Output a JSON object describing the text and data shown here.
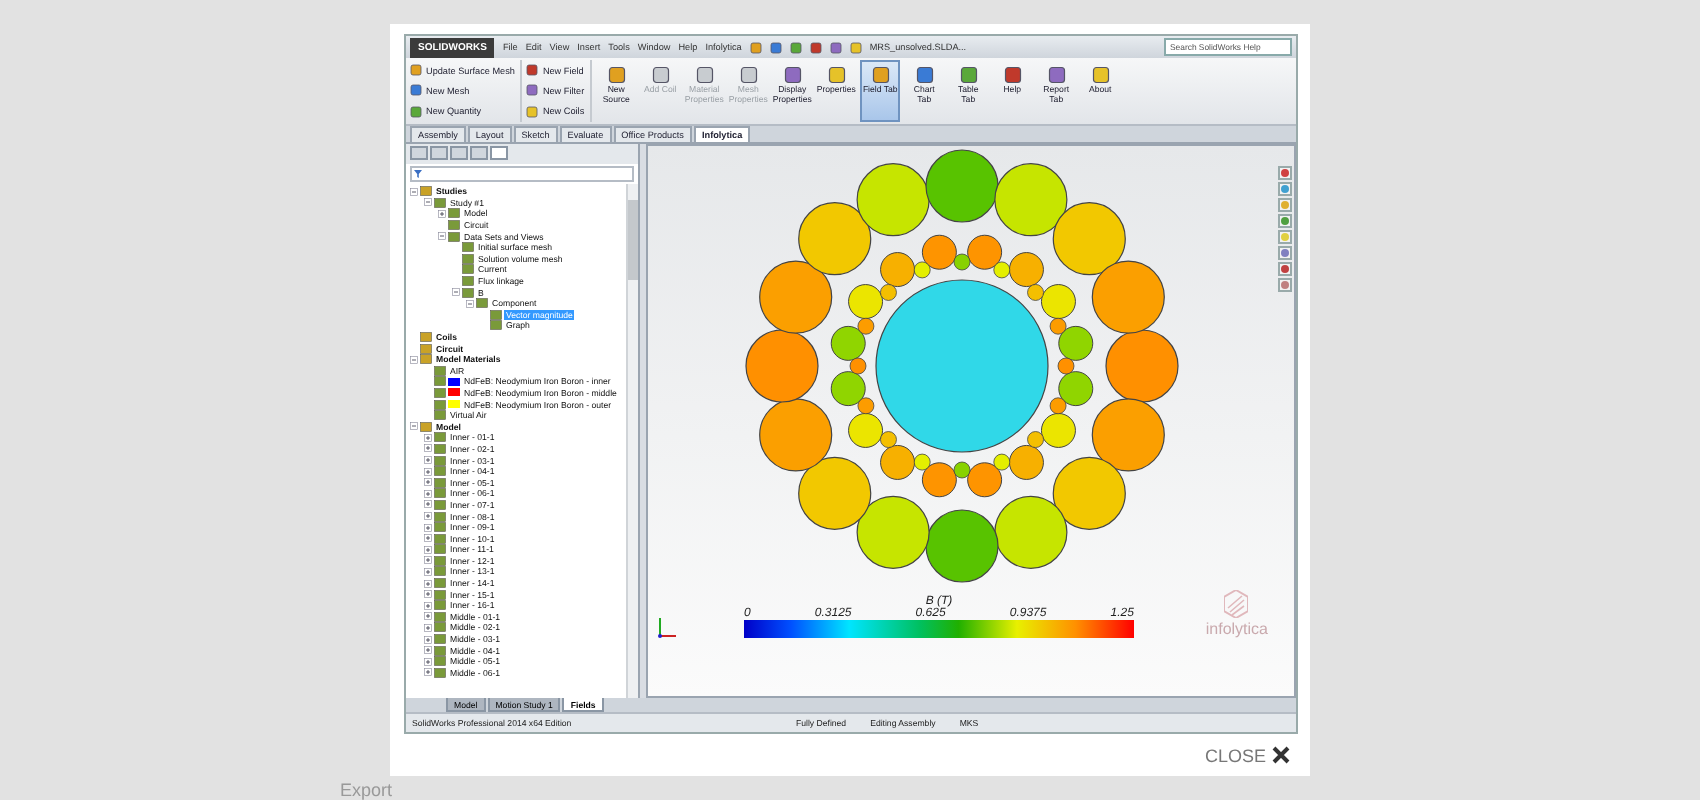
{
  "app": {
    "logo": "SOLIDWORKS",
    "menu": [
      "File",
      "Edit",
      "View",
      "Insert",
      "Tools",
      "Window",
      "Help",
      "Infolytica"
    ],
    "document_title": "MRS_unsolved.SLDA...",
    "search": {
      "placeholder": "Search SolidWorks Help"
    }
  },
  "ribbon": {
    "small_commands": [
      {
        "label": "Update Surface Mesh"
      },
      {
        "label": "New Mesh"
      },
      {
        "label": "New Quantity"
      },
      {
        "label": "New Field"
      },
      {
        "label": "New Filter"
      },
      {
        "label": "New Coils"
      }
    ],
    "large_commands": [
      {
        "label": "New Source",
        "disabled": false,
        "selected": false
      },
      {
        "label": "Add Coil",
        "disabled": true,
        "selected": false
      },
      {
        "label": "Material Properties",
        "disabled": true,
        "selected": false
      },
      {
        "label": "Mesh Properties",
        "disabled": true,
        "selected": false
      },
      {
        "label": "Display Properties",
        "disabled": false,
        "selected": false
      },
      {
        "label": "Properties",
        "disabled": false,
        "selected": false
      },
      {
        "label": "Field Tab",
        "disabled": false,
        "selected": true
      },
      {
        "label": "Chart Tab",
        "disabled": false,
        "selected": false
      },
      {
        "label": "Table Tab",
        "disabled": false,
        "selected": false
      },
      {
        "label": "Help",
        "disabled": false,
        "selected": false
      },
      {
        "label": "Report Tab",
        "disabled": false,
        "selected": false
      },
      {
        "label": "About",
        "disabled": false,
        "selected": false
      }
    ]
  },
  "tabs": [
    {
      "label": "Assembly",
      "selected": false
    },
    {
      "label": "Layout",
      "selected": false
    },
    {
      "label": "Sketch",
      "selected": false
    },
    {
      "label": "Evaluate",
      "selected": false
    },
    {
      "label": "Office Products",
      "selected": false
    },
    {
      "label": "Infolytica",
      "selected": true
    }
  ],
  "panel_tabs": [
    {
      "selected": false
    },
    {
      "selected": false
    },
    {
      "selected": false
    },
    {
      "selected": false
    },
    {
      "selected": true
    }
  ],
  "tree": [
    {
      "label": "Studies",
      "selected": false,
      "expanded": true,
      "children": [
        {
          "label": "Study #1",
          "selected": false,
          "expanded": true,
          "children": [
            {
              "label": "Model",
              "selected": false,
              "expanded": false
            },
            {
              "label": "Circuit",
              "selected": false
            },
            {
              "label": "Data Sets and Views",
              "selected": false,
              "expanded": true,
              "children": [
                {
                  "label": "Initial surface mesh",
                  "selected": false
                },
                {
                  "label": "Solution volume mesh",
                  "selected": false
                },
                {
                  "label": "Current",
                  "selected": false
                },
                {
                  "label": "Flux linkage",
                  "selected": false
                },
                {
                  "label": "B",
                  "selected": false,
                  "expanded": true,
                  "children": [
                    {
                      "label": "Component",
                      "selected": false,
                      "expanded": true,
                      "children": [
                        {
                          "label": "Vector magnitude",
                          "selected": true
                        },
                        {
                          "label": "Graph",
                          "selected": false
                        }
                      ]
                    }
                  ]
                }
              ]
            }
          ]
        }
      ]
    },
    {
      "label": "Coils",
      "selected": false
    },
    {
      "label": "Circuit",
      "selected": false
    },
    {
      "label": "Model Materials",
      "selected": false,
      "expanded": true,
      "children": [
        {
          "label": "AIR",
          "selected": false
        },
        {
          "label": "NdFeB: Neodymium Iron Boron - inner",
          "selected": false,
          "color": "#0000ff"
        },
        {
          "label": "NdFeB: Neodymium Iron Boron - middle",
          "selected": false,
          "color": "#ff0000"
        },
        {
          "label": "NdFeB: Neodymium Iron Boron - outer",
          "selected": false,
          "color": "#ffff00"
        },
        {
          "label": "Virtual Air",
          "selected": false
        }
      ]
    },
    {
      "label": "Model",
      "selected": false,
      "expanded": true,
      "children": [
        {
          "label": "Inner - 01-1",
          "selected": false,
          "expanded": false
        },
        {
          "label": "Inner - 02-1",
          "selected": false,
          "expanded": false
        },
        {
          "label": "Inner - 03-1",
          "selected": false,
          "expanded": false
        },
        {
          "label": "Inner - 04-1",
          "selected": false,
          "expanded": false
        },
        {
          "label": "Inner - 05-1",
          "selected": false,
          "expanded": false
        },
        {
          "label": "Inner - 06-1",
          "selected": false,
          "expanded": false
        },
        {
          "label": "Inner - 07-1",
          "selected": false,
          "expanded": false
        },
        {
          "label": "Inner - 08-1",
          "selected": false,
          "expanded": false
        },
        {
          "label": "Inner - 09-1",
          "selected": false,
          "expanded": false
        },
        {
          "label": "Inner - 10-1",
          "selected": false,
          "expanded": false
        },
        {
          "label": "Inner - 11-1",
          "selected": false,
          "expanded": false
        },
        {
          "label": "Inner - 12-1",
          "selected": false,
          "expanded": false
        },
        {
          "label": "Inner - 13-1",
          "selected": false,
          "expanded": false
        },
        {
          "label": "Inner - 14-1",
          "selected": false,
          "expanded": false
        },
        {
          "label": "Inner - 15-1",
          "selected": false,
          "expanded": false
        },
        {
          "label": "Inner - 16-1",
          "selected": false,
          "expanded": false
        },
        {
          "label": "Middle - 01-1",
          "selected": false,
          "expanded": false
        },
        {
          "label": "Middle - 02-1",
          "selected": false,
          "expanded": false
        },
        {
          "label": "Middle - 03-1",
          "selected": false,
          "expanded": false
        },
        {
          "label": "Middle - 04-1",
          "selected": false,
          "expanded": false
        },
        {
          "label": "Middle - 05-1",
          "selected": false,
          "expanded": false
        },
        {
          "label": "Middle - 06-1",
          "selected": false,
          "expanded": false
        }
      ]
    }
  ],
  "colorbar": {
    "title": "B (T)",
    "ticks": [
      "0",
      "0.3125",
      "0.625",
      "0.9375",
      "1.25"
    ]
  },
  "viewport_logo": "infolytica",
  "bottom_tabs": [
    {
      "label": "Model",
      "selected": false
    },
    {
      "label": "Motion Study 1",
      "selected": false
    },
    {
      "label": "Fields",
      "selected": true
    }
  ],
  "status_bar": {
    "edition": "SolidWorks Professional 2014 x64 Edition",
    "items": [
      "Fully Defined",
      "Editing Assembly",
      "MKS"
    ]
  },
  "close_label": "CLOSE",
  "background_text": "Export"
}
